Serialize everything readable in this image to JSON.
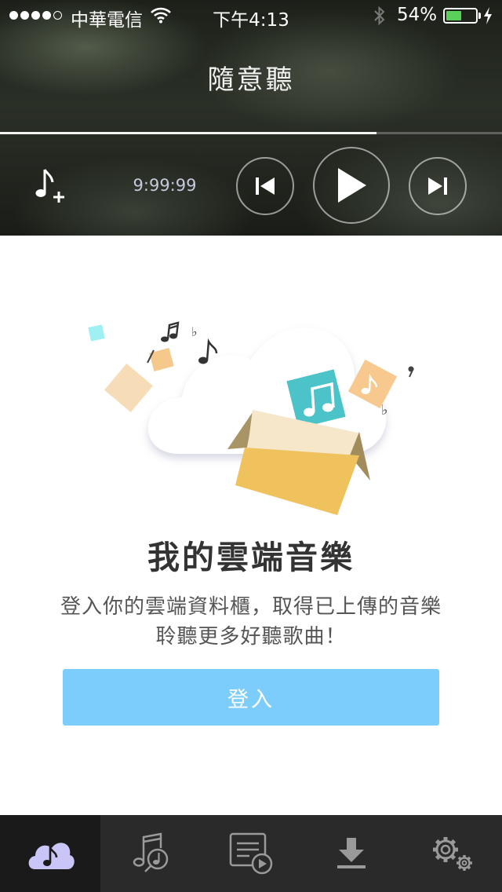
{
  "status_bar": {
    "carrier": "中華電信",
    "time": "下午4:13",
    "battery": "54%",
    "battery_level": 0.54
  },
  "player": {
    "title": "隨意聽",
    "elapsed": "9:99:99",
    "progress": 0.75
  },
  "main": {
    "heading": "我的雲端音樂",
    "description_line1": "登入你的雲端資料櫃，取得已上傳的音樂",
    "description_line2": "聆聽更多好聽歌曲！",
    "login_label": "登入"
  },
  "tabs": [
    {
      "icon": "cloud-music-icon",
      "active": true
    },
    {
      "icon": "music-library-icon",
      "active": false
    },
    {
      "icon": "playlist-icon",
      "active": false
    },
    {
      "icon": "download-icon",
      "active": false
    },
    {
      "icon": "settings-icon",
      "active": false
    }
  ],
  "colors": {
    "accent": "#7ccdfc",
    "tab_active_icon": "#c9c6f7",
    "tab_bar": "#2a2a2a",
    "battery": "#5ad15a"
  }
}
